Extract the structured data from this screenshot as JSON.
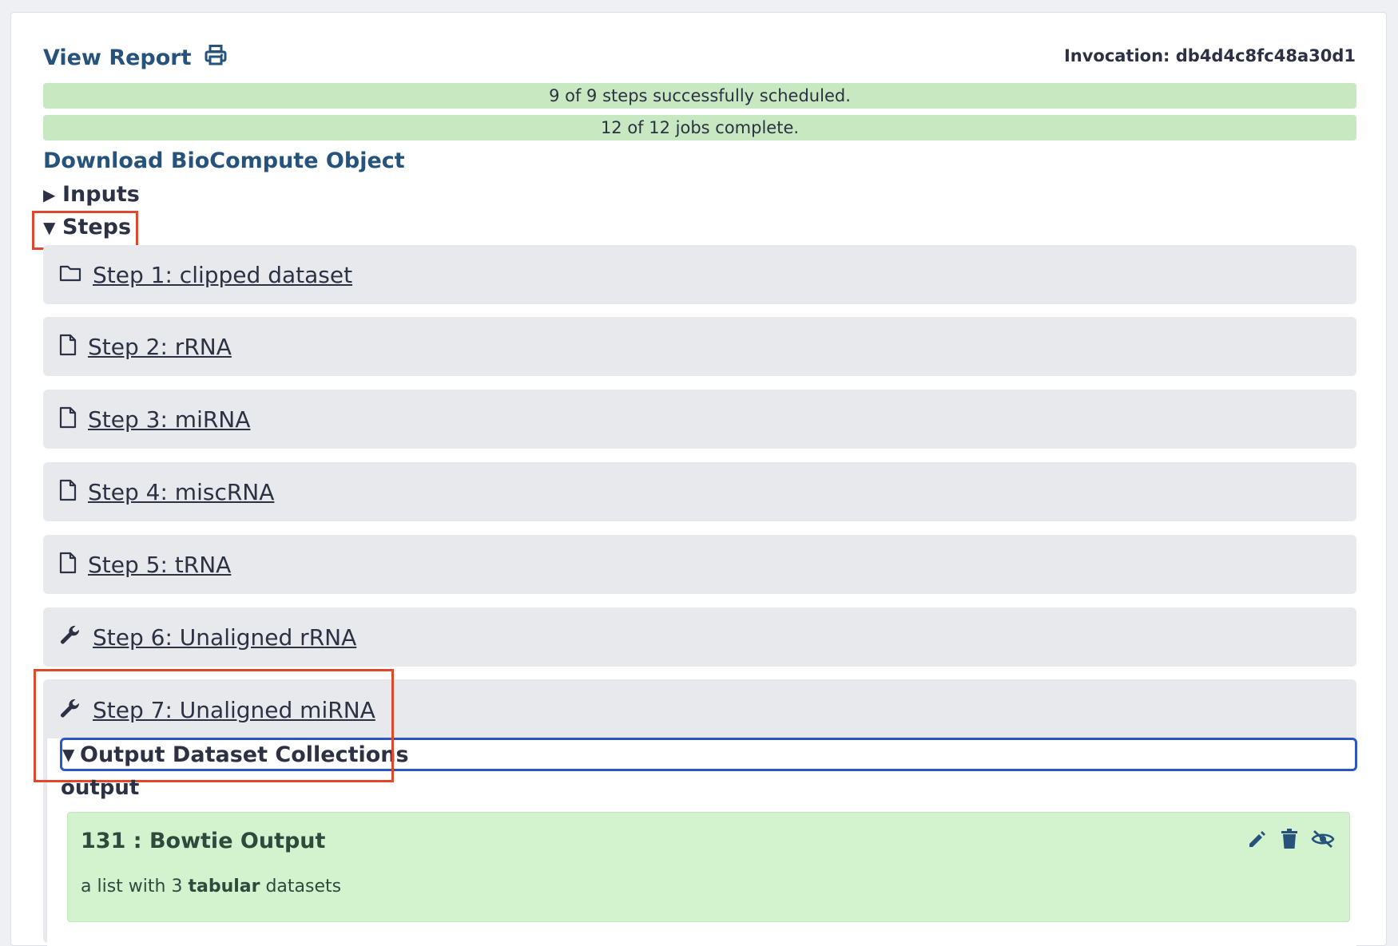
{
  "header": {
    "view_report_label": "View Report",
    "invocation_label": "Invocation: db4d4c8fc48a30d1"
  },
  "status": {
    "steps_scheduled": "9 of 9 steps successfully scheduled.",
    "jobs_complete": "12 of 12 jobs complete."
  },
  "download_label": "Download BioCompute Object",
  "sections": {
    "inputs_label": "Inputs",
    "steps_label": "Steps"
  },
  "steps": [
    {
      "label": "Step 1: clipped dataset",
      "icon": "folder-icon"
    },
    {
      "label": "Step 2: rRNA",
      "icon": "file-icon"
    },
    {
      "label": "Step 3: miRNA",
      "icon": "file-icon"
    },
    {
      "label": "Step 4: miscRNA",
      "icon": "file-icon"
    },
    {
      "label": "Step 5: tRNA",
      "icon": "file-icon"
    },
    {
      "label": "Step 6: Unaligned rRNA",
      "icon": "wrench-icon"
    },
    {
      "label": "Step 7: Unaligned miRNA",
      "icon": "wrench-icon"
    }
  ],
  "step7_detail": {
    "output_collections_label": "Output Dataset Collections",
    "output_label": "output",
    "collection": {
      "title": "131 : Bowtie Output",
      "desc_prefix": "a list with 3",
      "desc_type": "tabular",
      "desc_suffix": "datasets",
      "actions": [
        "pencil-icon",
        "trash-icon",
        "eye-slash-icon"
      ]
    }
  },
  "colors": {
    "link": "#25537b",
    "success_bar": "#c8e8c2",
    "collection_bg": "#d3f3cf",
    "highlight_red": "#e0482d",
    "focus_blue": "#2a56c6"
  }
}
